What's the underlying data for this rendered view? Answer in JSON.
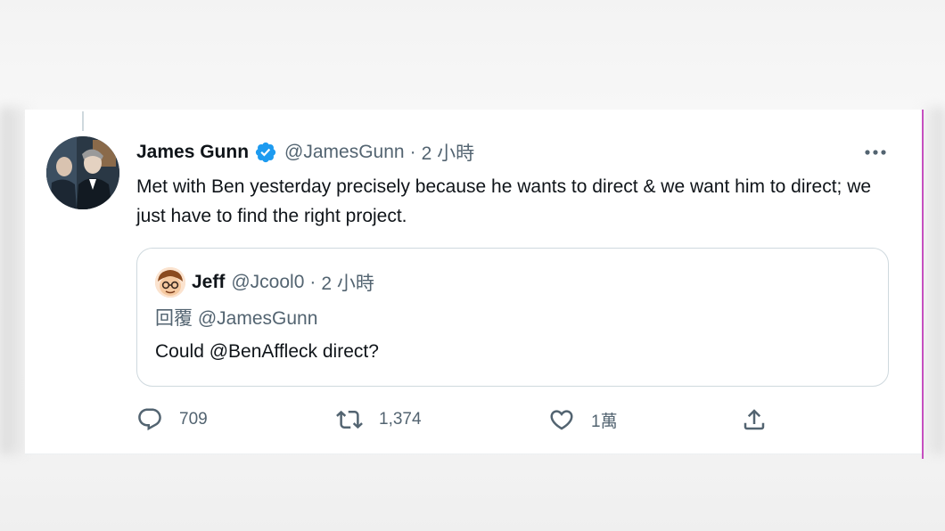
{
  "tweet": {
    "display_name": "James Gunn",
    "handle": "@JamesGunn",
    "separator": "·",
    "time": "2 小時",
    "text": "Met with Ben yesterday precisely because he wants to direct & we want him to direct; we just have to find the right project.",
    "icons": {
      "verified": "verified-badge-icon",
      "more": "more-dots-icon"
    },
    "colors": {
      "verified": "#1d9bf0",
      "text": "#0f1419",
      "secondary": "#536471",
      "border": "#cfd9de"
    }
  },
  "quote": {
    "display_name": "Jeff",
    "handle": "@Jcool0",
    "separator": "·",
    "time": "2 小時",
    "reply_to": "回覆 @JamesGunn",
    "text": "Could @BenAffleck direct?"
  },
  "actions": {
    "reply": {
      "icon": "reply-bubble-icon",
      "count": "709"
    },
    "retweet": {
      "icon": "retweet-icon",
      "count": "1,374"
    },
    "like": {
      "icon": "heart-icon",
      "count": "1萬"
    },
    "share": {
      "icon": "share-upload-icon"
    }
  }
}
